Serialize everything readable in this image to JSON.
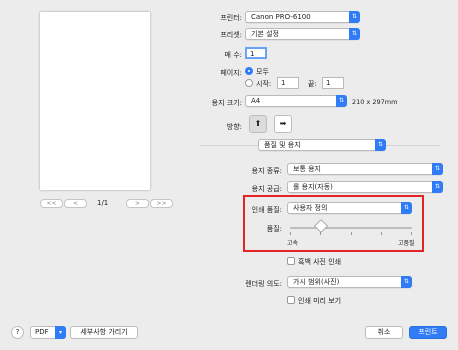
{
  "printer": {
    "label": "프린터:",
    "value": "Canon PRO-6100"
  },
  "preset": {
    "label": "프리셋:",
    "value": "기본 설정"
  },
  "copies": {
    "label": "매 수:",
    "value": "1"
  },
  "pages": {
    "label": "페이지:",
    "all": "모두",
    "from_label": "시작:",
    "from_value": "1",
    "to_label": "끝:",
    "to_value": "1"
  },
  "paper_size": {
    "label": "용지 크기:",
    "value": "A4",
    "dims": "210 x 297mm"
  },
  "orientation": {
    "label": "방향:"
  },
  "section": {
    "value": "품질 및 용지"
  },
  "media_type": {
    "label": "용지 종류:",
    "value": "보통 용지"
  },
  "paper_source": {
    "label": "용지 공급:",
    "value": "롤 용지(자동)"
  },
  "print_quality": {
    "label": "인쇄 품질:",
    "value": "사용자 정의"
  },
  "quality": {
    "label": "품질:",
    "min_label": "고속",
    "max_label": "고품질",
    "level": 0.25
  },
  "grayscale": {
    "label": "흑백 사진 인쇄"
  },
  "rendering": {
    "label": "렌더링 의도:",
    "value": "가시 범위(사진)"
  },
  "print_preview": {
    "label": "인쇄 미리 보기"
  },
  "pager": {
    "first": "<<",
    "prev": "<",
    "page": "1/1",
    "next": ">",
    "last": ">>"
  },
  "footer": {
    "help": "?",
    "pdf": "PDF",
    "details": "세부사항 가리기",
    "cancel": "취소",
    "print": "프린트"
  }
}
